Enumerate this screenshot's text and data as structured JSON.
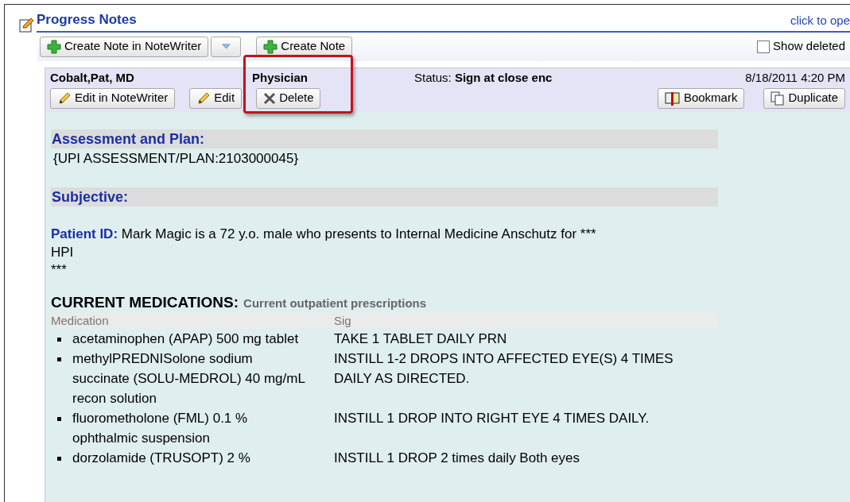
{
  "panel": {
    "title": "Progress Notes",
    "link": "click to ope"
  },
  "toolbar": {
    "buttons": [
      {
        "label": "Create Note in NoteWriter",
        "kind": "create"
      },
      {
        "kind": "dropdown"
      },
      {
        "label": "Create Note",
        "kind": "create"
      }
    ],
    "show_deleted": {
      "label": "Show deleted",
      "checked": false
    }
  },
  "note": {
    "author": "Cobalt,Pat, MD",
    "role": "Physician",
    "status_label": "Status:",
    "status": "Sign at close enc",
    "datetime": "8/18/2011 4:20 PM",
    "left_buttons": [
      {
        "label": "Edit in NoteWriter",
        "kind": "pencil",
        "highlighted": false
      },
      {
        "label": "Edit",
        "kind": "pencil",
        "highlighted": false
      },
      {
        "label": "Delete",
        "kind": "delete",
        "highlighted": true
      }
    ],
    "right_buttons": [
      {
        "label": "Bookmark",
        "kind": "bookmark"
      },
      {
        "label": "Duplicate",
        "kind": "duplicate"
      }
    ]
  },
  "sections": [
    {
      "kind": "heading",
      "text": "Assessment and Plan:"
    },
    {
      "kind": "text",
      "text": "{UPI ASSESSMENT/PLAN:2103000045}"
    },
    {
      "kind": "heading",
      "text": "Subjective:"
    },
    {
      "kind": "patient",
      "label": "Patient ID:",
      "text": "Mark Magic is a 72 y.o. male who presents to Internal Medicine Anschutz for ***",
      "lines": [
        "HPI",
        "***"
      ]
    }
  ],
  "medications": {
    "title": "CURRENT MEDICATIONS:",
    "subtitle": "Current outpatient prescriptions",
    "columns": [
      "Medication",
      "Sig"
    ],
    "rows": [
      {
        "name": "acetaminophen (APAP) 500 mg tablet",
        "sig": "TAKE 1 TABLET DAILY PRN"
      },
      {
        "name": "methylPREDNISolone sodium succinate (SOLU-MEDROL) 40 mg/mL recon solution",
        "sig": "INSTILL 1-2 DROPS INTO AFFECTED EYE(S)  4 TIMES DAILY AS DIRECTED."
      },
      {
        "name": "fluorometholone (FML) 0.1 % ophthalmic suspension",
        "sig": "INSTILL 1 DROP INTO RIGHT EYE 4 TIMES DAILY."
      },
      {
        "name": "dorzolamide (TRUSOPT) 2 %",
        "sig": "INSTILL 1 DROP 2 times daily Both eyes"
      }
    ]
  }
}
